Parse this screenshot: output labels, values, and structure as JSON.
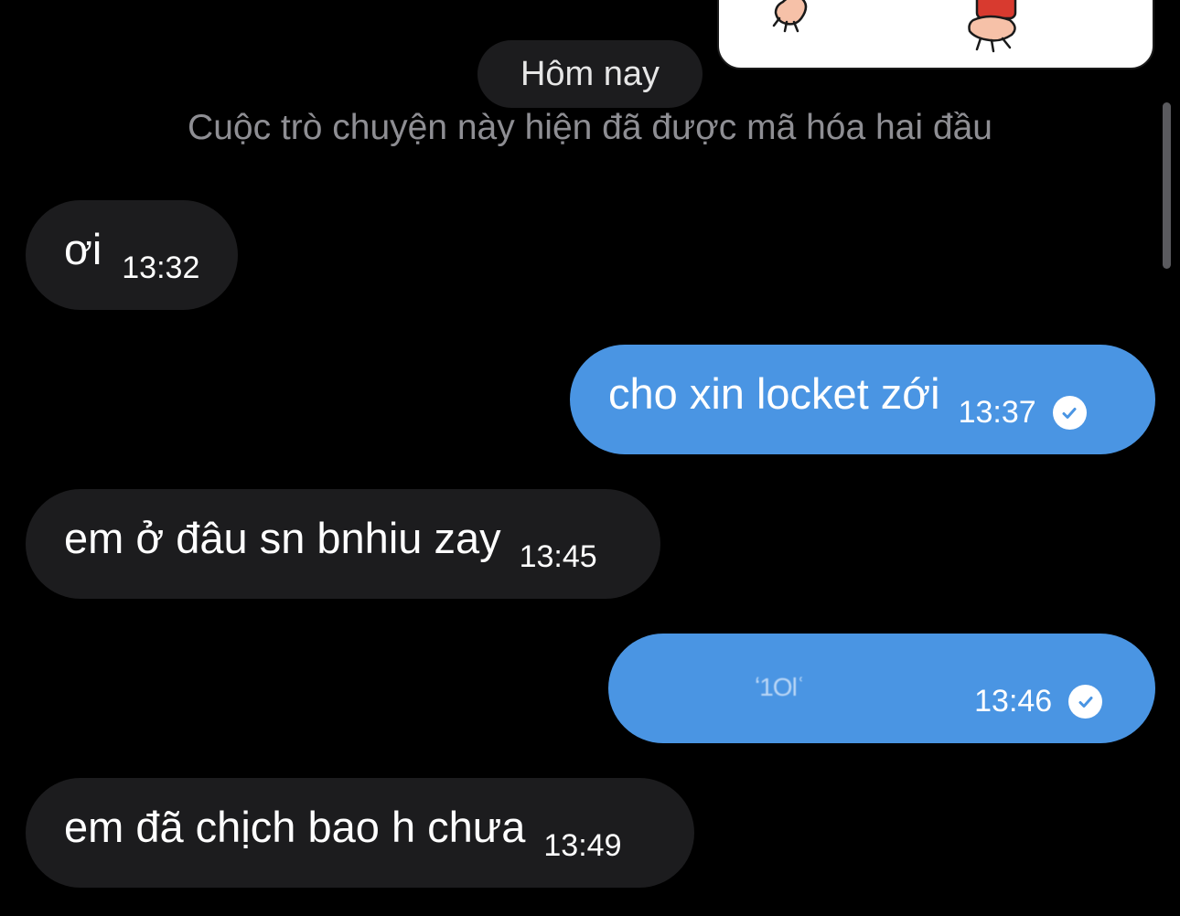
{
  "date_separator": "Hôm nay",
  "encryption_notice": "Cuộc trò chuyện này hiện đã được mã hóa hai đầu",
  "messages": [
    {
      "direction": "incoming",
      "text": "ơi",
      "time": "13:32"
    },
    {
      "direction": "outgoing",
      "text": "cho xin locket zới",
      "time": "13:37",
      "status_icon": "sent-check-icon"
    },
    {
      "direction": "incoming",
      "text": "em ở đâu sn bnhiu zay",
      "time": "13:45"
    },
    {
      "direction": "outgoing",
      "text": "ʻ1Olʿ",
      "time": "13:46",
      "status_icon": "sent-check-icon"
    },
    {
      "direction": "incoming",
      "text": "em đã chịch bao h chưa",
      "time": "13:49"
    }
  ],
  "colors": {
    "background": "#000000",
    "incoming_bubble": "#1c1c1e",
    "outgoing_bubble": "#4a95e3",
    "notice_text": "#8e8e93"
  }
}
